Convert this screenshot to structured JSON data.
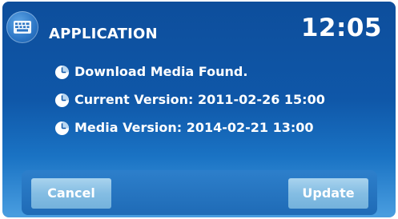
{
  "header": {
    "app_icon": "keyboard-icon",
    "title": "APPLICATION",
    "clock": "12:05"
  },
  "info": {
    "icon": "clock-icon",
    "items": [
      {
        "text": "Download Media Found."
      },
      {
        "text": "Current Version: 2011-02-26 15:00"
      },
      {
        "text": "Media Version: 2014-02-21 13:00"
      }
    ]
  },
  "buttons": {
    "cancel_label": "Cancel",
    "update_label": "Update"
  },
  "colors": {
    "background_top": "#0d4e9c",
    "background_bottom": "#4a9ee0",
    "button": "#84bde3",
    "text": "#ffffff"
  }
}
